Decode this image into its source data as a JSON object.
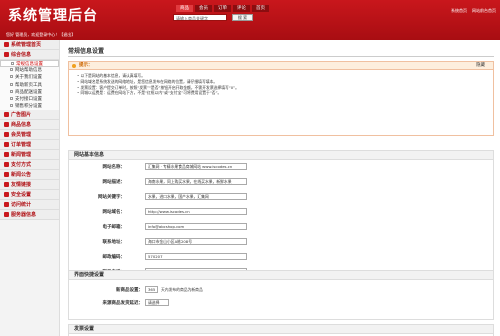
{
  "header": {
    "title": "系统管理后台",
    "welcome": "您好 管理员，欢迎登录中心！【退出】",
    "nav": [
      "商品",
      "会员",
      "订单",
      "评论",
      "首页"
    ],
    "search_value": "请输入商品关键字",
    "search_button": "搜 索",
    "links": [
      "系统首页",
      "网站前台首页"
    ]
  },
  "sidebar": [
    {
      "label": "系统管理首页",
      "items": []
    },
    {
      "label": "综合信息",
      "items": [
        "常规信息设置",
        "网站帮助信息",
        "关于我们设置",
        "帮助新页工具",
        "商品配送设置",
        "支付接口设置",
        "销售积分设置"
      ]
    },
    {
      "label": "广告图片",
      "items": []
    },
    {
      "label": "商品信息",
      "items": []
    },
    {
      "label": "会员管理",
      "items": []
    },
    {
      "label": "订单管理",
      "items": []
    },
    {
      "label": "新闻管理",
      "items": []
    },
    {
      "label": "支付方式",
      "items": []
    },
    {
      "label": "新闻公告",
      "items": []
    },
    {
      "label": "友情链接",
      "items": []
    },
    {
      "label": "安全设置",
      "items": []
    },
    {
      "label": "访问统计",
      "items": []
    },
    {
      "label": "服务器信息",
      "items": []
    }
  ],
  "main": {
    "title": "常规信息设置",
    "tips": {
      "title": "提示：",
      "hide": "隐藏",
      "lines": [
        "以下是网站的基本信息，请认真填写。",
        "网站域名是系统发送的网络地址，是您信息发布在网络的位置，请仔细填写填本。",
        "发票设置：客户提交订单时，按照“发票”“是否”按钮开启开取金额，不需开发票选择填写“0”。",
        "同城以运费是：运费在网站下方，不是“红框以内”或“支付宝”可将费用设置于“否”。"
      ]
    },
    "basic": {
      "title": "网站基本信息",
      "rows": [
        {
          "label": "网站名称：",
          "value": "汇集网 · 专精水果食品商城网站 www.iscodes.cn"
        },
        {
          "label": "网站描述：",
          "value": "海南水果，同上购买水果，在线买水果，新鲜水果"
        },
        {
          "label": "网站关键字：",
          "value": "水果，进口水果，国产水果，汇集网"
        },
        {
          "label": "网站域名：",
          "value": "http://www.iscodes.cn"
        },
        {
          "label": "电子邮箱：",
          "value": "info@abcshop.com"
        },
        {
          "label": "联系地址：",
          "value": "海口市金山小区A栋208号"
        },
        {
          "label": "邮政编码：",
          "value": "570207"
        },
        {
          "label": "联系电话：",
          "value": "400-800-1800"
        },
        {
          "label": "传真号码：",
          "value": "0898-66668700"
        }
      ]
    },
    "display": {
      "title": "界面快捷设置",
      "rows": [
        {
          "label": "新商品设置：",
          "value": "365",
          "hint": "天内发布的商品为新商品"
        },
        {
          "label": "来源商品发货延迟：",
          "value": "请选择",
          "hint": ""
        }
      ]
    },
    "invoice": {
      "title": "发票设置"
    }
  }
}
